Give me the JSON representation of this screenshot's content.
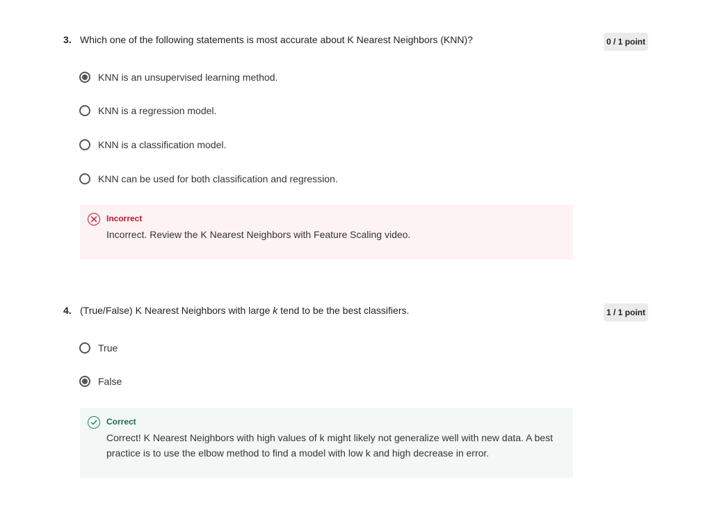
{
  "questions": [
    {
      "number": "3.",
      "text": "Which one of the following statements is most accurate about K Nearest Neighbors (KNN)?",
      "points": "0 / 1 point",
      "options": [
        {
          "label": "KNN is an unsupervised learning method.",
          "selected": true
        },
        {
          "label": "KNN is a regression model.",
          "selected": false
        },
        {
          "label": "KNN is a classification model.",
          "selected": false
        },
        {
          "label": "KNN can be used for both classification and regression.",
          "selected": false
        }
      ],
      "feedback": {
        "status": "incorrect",
        "title": "Incorrect",
        "text": "Incorrect. Review the K Nearest Neighbors with Feature Scaling video."
      }
    },
    {
      "number": "4.",
      "text_before": "(True/False) K Nearest Neighbors with large ",
      "text_em": "k",
      "text_after": " tend to be the best classifiers.",
      "points": "1 / 1 point",
      "options": [
        {
          "label": "True",
          "selected": false
        },
        {
          "label": "False",
          "selected": true
        }
      ],
      "feedback": {
        "status": "correct",
        "title": "Correct",
        "text": "Correct! K Nearest Neighbors with high values of k might likely not generalize well with new data. A best practice is to use the elbow method to find a model with low k and high decrease in error."
      }
    }
  ],
  "colors": {
    "incorrect": "#c4122f",
    "correct": "#1b8755",
    "incorrect_bg": "#fdf3f4",
    "correct_bg": "#f3f8f6",
    "badge_bg": "#ebebeb"
  },
  "icons": {
    "incorrect": "x-circle-icon",
    "correct": "check-circle-icon"
  }
}
